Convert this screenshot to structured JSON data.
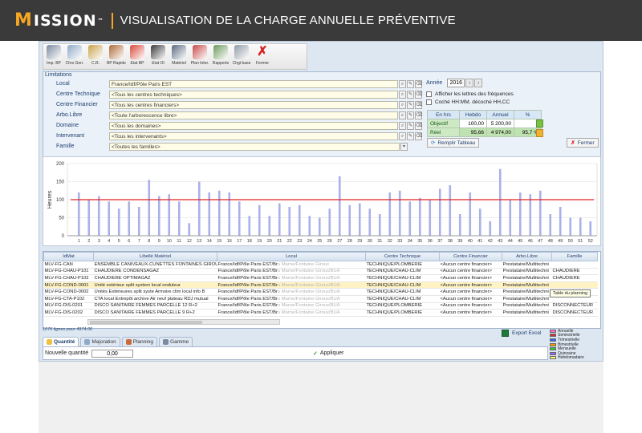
{
  "header": {
    "logo_text": "ISSION",
    "logo_m": "M",
    "logo_tm": "™",
    "page_title": "VISUALISATION DE LA CHARGE ANNUELLE PRÉVENTIVE"
  },
  "toolbar": [
    {
      "label": "Imp. BP",
      "icon": "printer-icon",
      "color": "#7a8aa0"
    },
    {
      "label": "Chrs Gen.",
      "icon": "plane-icon",
      "color": "#8fa9c8"
    },
    {
      "label": "C.R.",
      "icon": "edit-icon",
      "color": "#c8a24a"
    },
    {
      "label": "BP Rapide",
      "icon": "pen-icon",
      "color": "#b06a3a"
    },
    {
      "label": "Etat BP",
      "icon": "cubes-icon",
      "color": "#d84a3a"
    },
    {
      "label": "Etat OI",
      "icon": "traffic-light-icon",
      "color": "#3a3a3a"
    },
    {
      "label": "Matériel",
      "icon": "gears-icon",
      "color": "#5a6a80"
    },
    {
      "label": "Plan Inter.",
      "icon": "calendar-icon",
      "color": "#c84a4a"
    },
    {
      "label": "Rapports",
      "icon": "reports-icon",
      "color": "#6a9a5a"
    },
    {
      "label": "Chgt base",
      "icon": "key-icon",
      "color": "#909aa5"
    },
    {
      "label": "Fermer",
      "icon": "close-icon",
      "color": "#d82020"
    }
  ],
  "limitations": {
    "title": "Limitations",
    "fields": [
      {
        "label": "Local",
        "value": "France/Idf/Pôle Paris EST"
      },
      {
        "label": "Centre Technique",
        "value": "<Tous les centres techniques>"
      },
      {
        "label": "Centre Financier",
        "value": "<Tous les centres financiers>"
      },
      {
        "label": "Arbo.Libre",
        "value": "<Toute l'arborescence libre>"
      },
      {
        "label": "Domaine",
        "value": "<Tous les domaines>"
      },
      {
        "label": "Intervenant",
        "value": "<Tous les intervenants>"
      },
      {
        "label": "Famille",
        "value": "<Toutes les familles>"
      }
    ],
    "annee_label": "Année",
    "annee_value": "2016",
    "checkbox_frequences": "Afficher les lettres des fréquences",
    "checkbox_hhmm": "Coché HH:MM, décoché HH,CC",
    "stats_headers": [
      "En hrs",
      "Hebdo",
      "Annuel",
      "%"
    ],
    "stats_rows": [
      {
        "label": "Objectif",
        "hebdo": "100,00",
        "annuel": "5 200,00",
        "pct": ""
      },
      {
        "label": "Réel",
        "hebdo": "95,66",
        "annuel": "4 974,00",
        "pct": "95,7 %"
      }
    ],
    "remplir_label": "Remplir Tableau",
    "fermer_label": "Fermer"
  },
  "chart_data": {
    "type": "bar",
    "ylabel": "Heures",
    "ylim": [
      0,
      200
    ],
    "yticks": [
      0,
      50,
      100,
      150,
      200
    ],
    "reference_line": 100,
    "reference_color": "#e02020",
    "bar_color": "#aab0e8",
    "categories": [
      "1",
      "2",
      "3",
      "4",
      "5",
      "6",
      "7",
      "8",
      "9",
      "10",
      "11",
      "12",
      "13",
      "14",
      "15",
      "16",
      "17",
      "18",
      "19",
      "20",
      "21",
      "22",
      "23",
      "24",
      "25",
      "26",
      "27",
      "28",
      "29",
      "30",
      "31",
      "32",
      "33",
      "34",
      "35",
      "36",
      "37",
      "38",
      "39",
      "40",
      "41",
      "42",
      "43",
      "44",
      "45",
      "46",
      "47",
      "48",
      "49",
      "50",
      "51",
      "52"
    ],
    "values": [
      120,
      100,
      110,
      95,
      75,
      95,
      80,
      155,
      110,
      115,
      95,
      35,
      150,
      120,
      125,
      120,
      95,
      55,
      85,
      55,
      90,
      80,
      85,
      55,
      50,
      75,
      165,
      85,
      90,
      75,
      60,
      120,
      125,
      95,
      105,
      100,
      130,
      140,
      60,
      120,
      75,
      40,
      185,
      100,
      120,
      115,
      125,
      60,
      80,
      50,
      50,
      40
    ]
  },
  "table": {
    "headers": [
      "IdMat",
      "Libellé Matériel",
      "Local",
      "Centre Technique",
      "Centre Financier",
      "Arbo.Libre",
      "Famille"
    ],
    "rows": [
      {
        "id": "MLV-FG-CAN",
        "lib": "ENSEMBLE CANIVEAUX-CUNETTES FONTAINES GIROUI",
        "local": "France/Idf/Pôle Paris EST/Br",
        "localb": "u Marne/Fontaine Giroux",
        "ct": "TECHNIQUE/PLOMBERIE",
        "cf": "<Aucun centre financier>",
        "arbo": "Prestataire/Multitechni",
        "fam": ""
      },
      {
        "id": "MLV-FG-CHAU-P101",
        "lib": "CHAUDIERE CONDENSAGAZ",
        "local": "France/Idf/Pôle Paris EST/Br",
        "localb": "u Marne/Fontaine Giroux/BUA",
        "ct": "TECHNIQUE/CHAU-CLIM",
        "cf": "<Aucun centre financier>",
        "arbo": "Prestataire/Multitechni",
        "fam": "CHAUDIERE"
      },
      {
        "id": "MLV-FG-CHAU-P102",
        "lib": "CHAUDIERE OPTIMAGAZ",
        "local": "France/Idf/Pôle Paris EST/Br",
        "localb": "u Marne/Fontaine Giroux/BUA",
        "ct": "TECHNIQUE/CHAU-CLIM",
        "cf": "<Aucun centre financier>",
        "arbo": "Prestataire/Multitechni",
        "fam": "CHAUDIERE"
      },
      {
        "id": "MLV-FG-COND-0001",
        "lib": "Unité extérieur split system local onduleur",
        "local": "France/Idf/Pôle Paris EST/Br",
        "localb": "u Marne/Fontaine Giroux/BUA",
        "ct": "TECHNIQUE/CHAU-CLIM",
        "cf": "<Aucun centre financier>",
        "arbo": "Prestataire/Multitechni",
        "fam": ""
      },
      {
        "id": "MLV-FG-COND-0002",
        "lib": "Unités Extérieures split syste Armoire clim local info B",
        "local": "France/Idf/Pôle Paris EST/Br",
        "localb": "u Marne/Fontaine Giroux/BUA",
        "ct": "TECHNIQUE/CHAU-CLIM",
        "cf": "<Aucun centre financier>",
        "arbo": "Prestataire/Multitechni",
        "fam": ""
      },
      {
        "id": "MLV-FG-CTA-P102",
        "lib": "CTA local Entrepôt archive Air neuf plateau RDJ mutual",
        "local": "France/Idf/Pôle Paris EST/Br",
        "localb": "u Marne/Fontaine Giroux/BUA",
        "ct": "TECHNIQUE/CHAU-CLIM",
        "cf": "<Aucun centre financier>",
        "arbo": "Prestataire/Multitechni",
        "fam": ""
      },
      {
        "id": "MLV-FG-DIS-0201",
        "lib": "DISCO SANITAIRE FEMMES PARCELLE 12 R+2",
        "local": "France/Idf/Pôle Paris EST/Br",
        "localb": "u Marne/Fontaine Giroux/BUA",
        "ct": "TECHNIQUE/PLOMBERIE",
        "cf": "<Aucun centre financier>",
        "arbo": "Prestataire/Multitechni",
        "fam": "DISCONNECTEUR"
      },
      {
        "id": "MLV-FG-DIS-0202",
        "lib": "DISCO SANITAIRE FEMMES PARCELLE 9 R+2",
        "local": "France/Idf/Pôle Paris EST/Br",
        "localb": "u Marne/Fontaine Giroux/BUA",
        "ct": "TECHNIQUE/PLOMBERIE",
        "cf": "<Aucun centre financier>",
        "arbo": "Prestataire/Multitechni",
        "fam": "DISCONNECTEUR"
      }
    ],
    "tooltip": "Table du planning",
    "row_count": "1076 lignes pour 4974.00"
  },
  "export_label": "Export Excel",
  "legend": [
    {
      "label": "Annuelle",
      "color": "#ff66cc"
    },
    {
      "label": "Semestrielle",
      "color": "#cc3333"
    },
    {
      "label": "Trimestrielle",
      "color": "#3366ff"
    },
    {
      "label": "Bimestrielle",
      "color": "#ff9900"
    },
    {
      "label": "Mensuelle",
      "color": "#33cc33"
    },
    {
      "label": "Quinzaine",
      "color": "#9966ff"
    },
    {
      "label": "Hebdomadaire",
      "color": "#ffff66"
    }
  ],
  "tabs": [
    {
      "label": "Quantité",
      "color": "#f0c040"
    },
    {
      "label": "Majoration",
      "color": "#8fa9c8"
    },
    {
      "label": "Planning",
      "color": "#c86a3a"
    },
    {
      "label": "Gamme",
      "color": "#7a8aa0"
    }
  ],
  "quantity": {
    "label": "Nouvelle quantité",
    "value": "0,00",
    "apply_label": "Appliquer"
  }
}
